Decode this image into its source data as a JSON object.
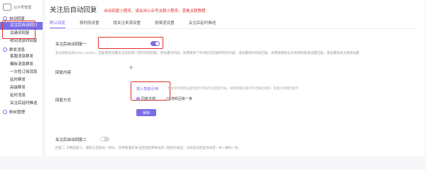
{
  "sidebar": {
    "brand": "公众号管理",
    "groups": [
      {
        "label": "自动回复",
        "items": [
          {
            "label": "关注后自动回复",
            "active": true
          },
          {
            "label": "关键词回复"
          },
          {
            "label": "收到消息时回复"
          }
        ]
      },
      {
        "label": "群发消息",
        "items": [
          {
            "label": "客服消息群发"
          },
          {
            "label": "模板消息群发"
          },
          {
            "label": "一次性订阅消息"
          },
          {
            "label": "延时群发"
          },
          {
            "label": "高级群发"
          },
          {
            "label": "延时消息"
          },
          {
            "label": "关注后延时推送"
          }
        ]
      },
      {
        "label": "粉丝管理",
        "items": []
      }
    ]
  },
  "main": {
    "title": "关注后自动回复",
    "note": "自动回复小程序，请关闭公众号关联小程序，查看关联教程",
    "tabs": [
      "默认回复",
      "按时段设置",
      "按关注来源设置",
      "按渠道设置",
      "关注后延时推送"
    ],
    "toggle1_label": "关注后自动回复一",
    "desc1": "关注后粉丝的(nick_name)，回复需要设置关注后延期一定时间后回复，请设置时间段，如需要某个时间段内回复特定的内容，请设置按时间段回复，如需根据粉丝的来源和渠道设置回复，请设置按关注来源设置",
    "content_label": "回复内容",
    "insert_var": "插入智能引用",
    "insert_hint": "回复中可使用这些智能引用来作为回复内容，如果回复内容不符合微信规则，智能引用将回复不",
    "method_label": "回复方式",
    "radio_all": "回复全部",
    "radio_random": "随机回复一条",
    "save": "保存",
    "toggle2_label": "关注后自动回复二",
    "desc2": "回复二 次数回复三，跟默认回复的一部分，且两者满足关注后回复需要设定+随机的类型，比如在前回复项设定一条+随机一条。",
    "accent": "#7a6ee8",
    "highlight": "#e0302c"
  }
}
